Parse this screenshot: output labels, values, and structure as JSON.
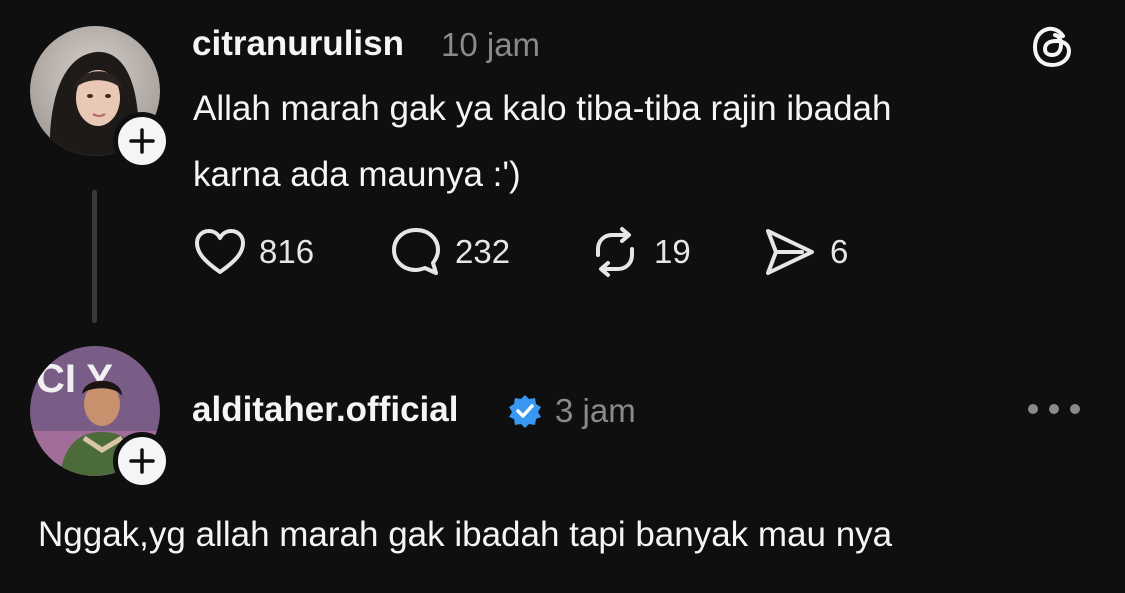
{
  "post": {
    "username": "citranurulisn",
    "time": "10 jam",
    "text_line1": "Allah marah gak ya kalo tiba-tiba rajin ibadah",
    "text_line2": "karna ada maunya :')",
    "likes": "816",
    "comments": "232",
    "reposts": "19",
    "shares": "6"
  },
  "reply": {
    "username": "alditaher.official",
    "verified": true,
    "time": "3 jam",
    "text": "Nggak,yg allah marah gak ibadah tapi banyak mau nya"
  },
  "icons": {
    "app_logo": "threads-logo-icon",
    "like": "heart-icon",
    "comment": "comment-bubble-icon",
    "repost": "repost-icon",
    "share": "send-icon",
    "follow": "plus-icon",
    "more": "more-dots-icon",
    "verified": "verified-badge-icon"
  },
  "colors": {
    "background": "#0f0f10",
    "text": "#f3f5f7",
    "secondary": "#8a8a8e",
    "verified": "#3897f0"
  }
}
